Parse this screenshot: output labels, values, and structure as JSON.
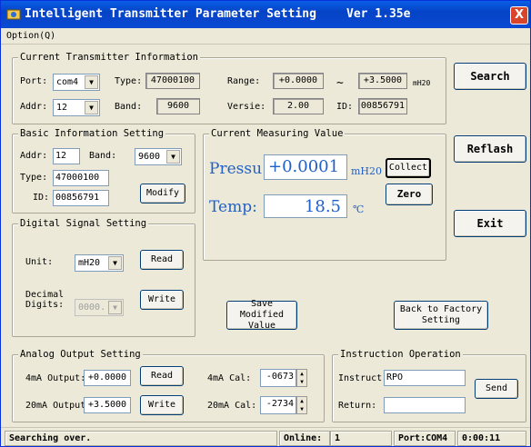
{
  "window": {
    "title": "Intelligent Transmitter Parameter Setting",
    "version": "Ver 1.35e",
    "close_label": "X"
  },
  "menu": {
    "option": "Option(Q)"
  },
  "current_info": {
    "legend": "Current Transmitter Information",
    "port_label": "Port:",
    "port_value": "com4",
    "type_label": "Type:",
    "type_value": "47000100",
    "range_label": "Range:",
    "range_low": "+0.0000",
    "range_sep": "~",
    "range_high": "+3.5000",
    "range_unit": "mH20",
    "addr_label": "Addr:",
    "addr_value": "12",
    "band_label": "Band:",
    "band_value": "9600",
    "versie_label": "Versie:",
    "versie_value": "2.00",
    "id_label": "ID:",
    "id_value": "00856791"
  },
  "basic_info": {
    "legend": "Basic Information Setting",
    "addr_label": "Addr:",
    "addr_value": "12",
    "band_label": "Band:",
    "band_value": "9600",
    "type_label": "Type:",
    "type_value": "47000100",
    "id_label": "ID:",
    "id_value": "00856791",
    "modify_label": "Modify"
  },
  "measuring": {
    "legend": "Current Measuring Value",
    "press_label": "Pressu",
    "press_value": "+0.0001",
    "press_unit": "mH20",
    "collect_label": "Collect",
    "temp_label": "Temp:",
    "temp_value": "18.5",
    "temp_unit": "℃",
    "zero_label": "Zero"
  },
  "side_buttons": {
    "search": "Search",
    "reflash": "Reflash",
    "exit": "Exit"
  },
  "digital": {
    "legend": "Digital Signal Setting",
    "unit_label": "Unit:",
    "unit_value": "mH20",
    "read_label": "Read",
    "decimal_label": "Decimal\nDigits:",
    "decimal_value": "0000.",
    "write_label": "Write"
  },
  "actions": {
    "save_modified": "Save Modified\nValue",
    "back_to_factory": "Back to Factory\nSetting"
  },
  "analog": {
    "legend": "Analog Output Setting",
    "out4_label": "4mA Output:",
    "out4_value": "+0.0000",
    "read_label": "Read",
    "cal4_label": "4mA Cal:",
    "cal4_value": "-0673",
    "out20_label": "20mA Output",
    "out20_value": "+3.5000",
    "write_label": "Write",
    "cal20_label": "20mA Cal:",
    "cal20_value": "-2734"
  },
  "instruction": {
    "legend": "Instruction Operation",
    "instruct_label": "Instruct",
    "instruct_value": "RPO",
    "return_label": "Return:",
    "return_value": "",
    "send_label": "Send"
  },
  "status": {
    "message": "Searching over.",
    "online_label": "Online:",
    "online_value": "1",
    "port": "Port:COM4",
    "time": "0:00:11"
  },
  "colors": {
    "titlebar": "#0543c6",
    "accent_text": "#2060c8",
    "window_bg": "#ece9d8"
  }
}
